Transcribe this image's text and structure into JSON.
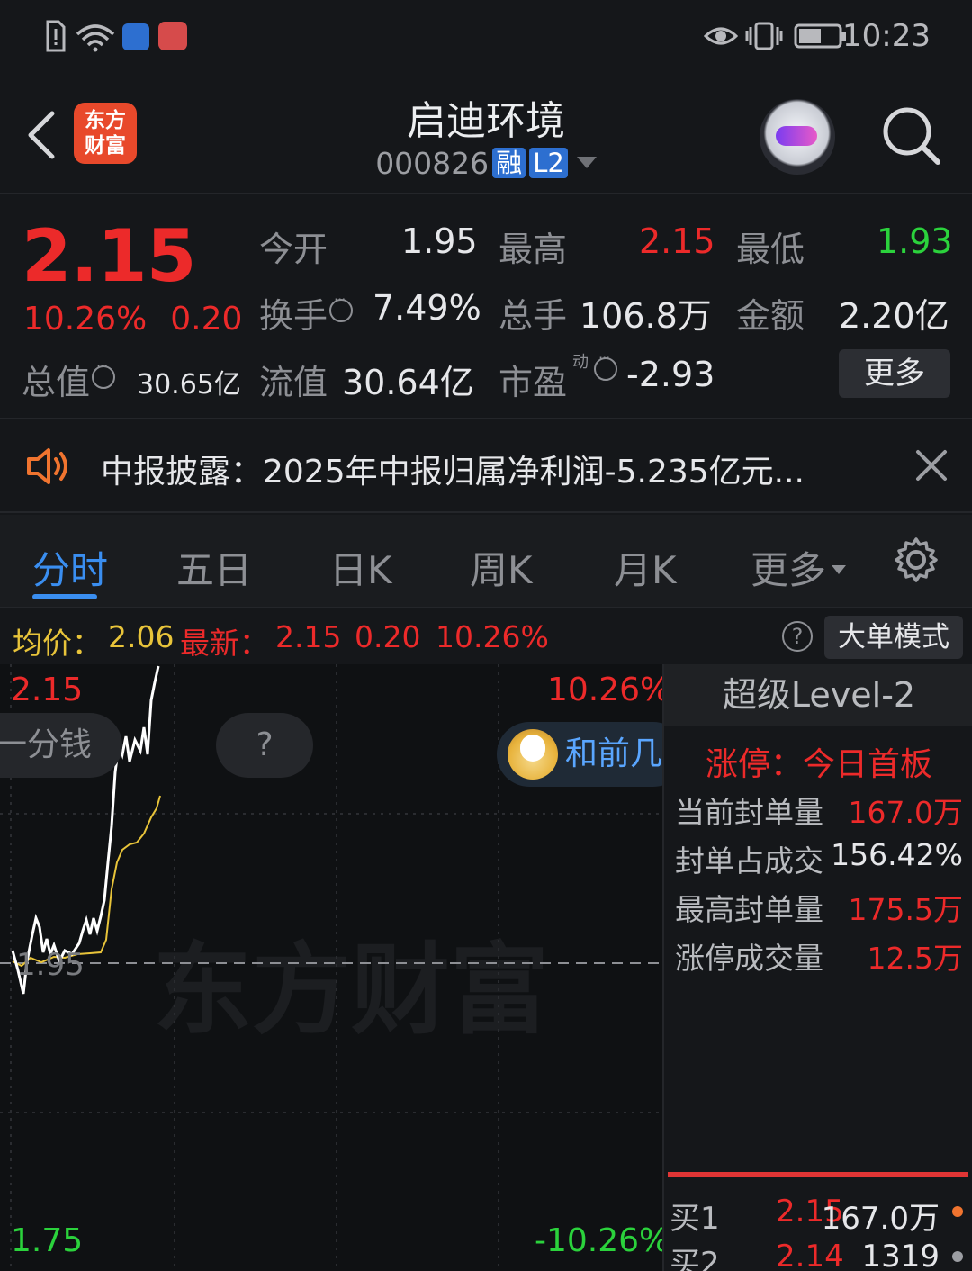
{
  "status_bar": {
    "time": "10:23"
  },
  "header": {
    "title": "启迪环境",
    "code": "000826",
    "badge_margin": "融",
    "badge_level": "L2",
    "logo_line1": "东方",
    "logo_line2": "财富"
  },
  "quote": {
    "price": "2.15",
    "change_pct": "10.26%",
    "change_abs": "0.20",
    "fields": {
      "open_label": "今开",
      "open_value": "1.95",
      "high_label": "最高",
      "high_value": "2.15",
      "low_label": "最低",
      "low_value": "1.93",
      "turnover_label": "换手",
      "turnover_value": "7.49%",
      "volume_label": "总手",
      "volume_value": "106.8万",
      "amount_label": "金额",
      "amount_value": "2.20亿",
      "mktcap_label": "总值",
      "mktcap_value": "30.65亿",
      "float_label": "流值",
      "float_value": "30.64亿",
      "pe_label": "市盈",
      "pe_sup": "动",
      "pe_value": "-2.93"
    },
    "more_label": "更多"
  },
  "notice": {
    "text": "中报披露：2025年中报归属净利润-5.235亿元..."
  },
  "tabs": [
    {
      "label": "分时"
    },
    {
      "label": "五日"
    },
    {
      "label": "日K"
    },
    {
      "label": "周K"
    },
    {
      "label": "月K"
    },
    {
      "label": "更多"
    }
  ],
  "infobar": {
    "avg_label": "均价：",
    "avg_value": "2.06",
    "latest_label": "最新：",
    "latest_value": "2.15",
    "latest_change": "0.20",
    "latest_pct": "10.26%",
    "mode_button": "大单模式"
  },
  "chart": {
    "y_top": "2.15",
    "y_mid": "1.95",
    "y_bottom": "1.75",
    "pct_top": "10.26%",
    "pct_bottom": "-10.26%",
    "pill_left": "一分钱",
    "pill_mid": "?",
    "hq_text": "和前几",
    "watermark": "东方财富",
    "colors": {
      "price_line": "#ffffff",
      "avg_line": "#e8c43a",
      "up": "#ec2a2a",
      "down": "#2bd23c"
    }
  },
  "level2": {
    "title": "超级Level-2",
    "subtitle": "涨停：今日首板",
    "rows": [
      {
        "label": "当前封单量",
        "value": "167.0万"
      },
      {
        "label": "封单占成交",
        "value": "156.42%"
      },
      {
        "label": "最高封单量",
        "value": "175.5万"
      },
      {
        "label": "涨停成交量",
        "value": "12.5万"
      }
    ],
    "orderbook": [
      {
        "label": "买1",
        "price": "2.15",
        "qty": "167.0万"
      },
      {
        "label": "买2",
        "price": "2.14",
        "qty": "1319"
      }
    ]
  }
}
